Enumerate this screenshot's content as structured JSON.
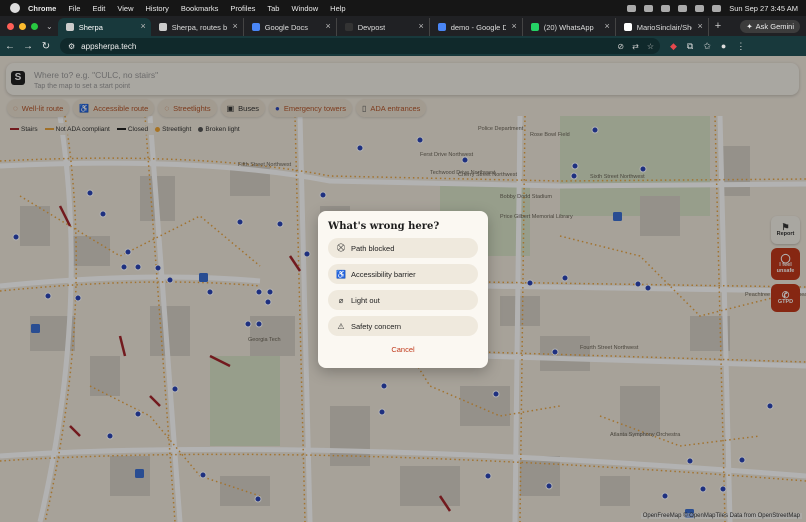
{
  "menubar": {
    "app": "Chrome",
    "items": [
      "File",
      "Edit",
      "View",
      "History",
      "Bookmarks",
      "Profiles",
      "Tab",
      "Window",
      "Help"
    ],
    "datetime": "Sun Sep 27  3:45 AM"
  },
  "tabs": [
    {
      "label": "Sherpa",
      "active": true
    },
    {
      "label": "Sherpa, routes built ar",
      "active": false
    },
    {
      "label": "Google Docs",
      "active": false
    },
    {
      "label": "Devpost",
      "active": false
    },
    {
      "label": "demo - Google Docs",
      "active": false
    },
    {
      "label": "(20) WhatsApp",
      "active": false
    },
    {
      "label": "MarioSinclair/Sherpa",
      "active": false
    }
  ],
  "browser": {
    "url": "appsherpa.tech",
    "ask_gemini": "Ask Gemini",
    "new_tab": "+"
  },
  "search": {
    "placeholder": "Where to? e.g. \"CULC, no stairs\"",
    "hint": "Tap the map to set a start point",
    "logo": "S"
  },
  "chips": [
    {
      "label": "Well-lit route",
      "icon": "lightbulb-icon",
      "glyph": "💡"
    },
    {
      "label": "Accessible route",
      "icon": "wheelchair-icon",
      "glyph": "♿"
    },
    {
      "label": "Streetlights",
      "icon": "lamp-icon",
      "glyph": "💡"
    },
    {
      "label": "Buses",
      "icon": "bus-icon",
      "glyph": "🚌"
    },
    {
      "label": "Emergency towers",
      "icon": "tower-icon",
      "glyph": "◉"
    },
    {
      "label": "ADA entrances",
      "icon": "door-icon",
      "glyph": "▯"
    }
  ],
  "legend": [
    {
      "label": "Stairs",
      "color": "#a4262c",
      "kind": "line"
    },
    {
      "label": "Not ADA compliant",
      "color": "#e6a13c",
      "kind": "line"
    },
    {
      "label": "Closed",
      "color": "#222222",
      "kind": "line"
    },
    {
      "label": "Streetlight",
      "color": "#f0a534",
      "kind": "dot"
    },
    {
      "label": "Broken light",
      "color": "#555555",
      "kind": "dot"
    }
  ],
  "side_buttons": {
    "report": "Report",
    "unsafe": "I feel unsafe",
    "gtpd": "GTPD"
  },
  "modal": {
    "title": "What's wrong here?",
    "options": [
      {
        "label": "Path blocked",
        "icon": "barrier-icon",
        "glyph": "⛒"
      },
      {
        "label": "Accessibility barrier",
        "icon": "wheelchair-icon",
        "glyph": "♿"
      },
      {
        "label": "Light out",
        "icon": "light-off-icon",
        "glyph": "⌀"
      },
      {
        "label": "Safety concern",
        "icon": "warning-icon",
        "glyph": "⚠"
      }
    ],
    "cancel": "Cancel"
  },
  "map_labels": [
    "Police Department",
    "Rose Bowl Field",
    "Price Gilbert Memorial Library",
    "Bobby Dodd Stadium",
    "Georgia Tech",
    "Atlanta Symphony Orchestra",
    "Sixth Street Northwest",
    "Fourth Street Northwest",
    "Fifth Street Northwest",
    "Techwood Drive Northwest",
    "Ferst Drive Northwest",
    "Cherry Street Northwest",
    "Peachtree Street Northeast"
  ],
  "attribution": "OpenFreeMap © OpenMapTiles Data from OpenStreetMap",
  "colors": {
    "accent": "#c0391b",
    "chip_text": "#b4552a",
    "map_bg": "#efe8dc",
    "tab_active": "#18393c"
  }
}
